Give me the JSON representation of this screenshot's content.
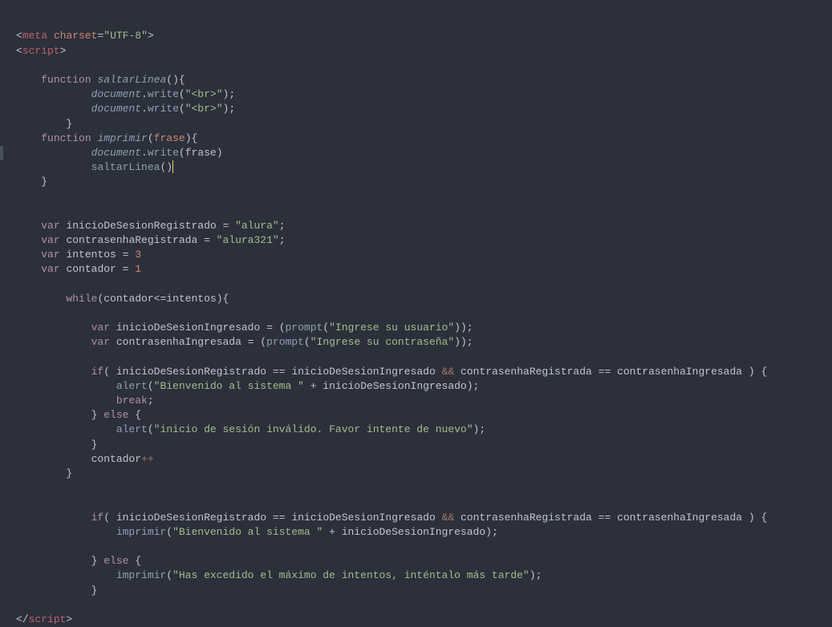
{
  "code": {
    "meta_open": "<",
    "meta_tag": "meta",
    "meta_attr": "charset",
    "meta_val": "\"UTF-8\"",
    "meta_close": ">",
    "script_open_l": "<",
    "script_tag": "script",
    "script_open_r": ">",
    "script_close_l": "</",
    "script_close_r": ">",
    "kw_function": "function",
    "fn_saltar": "saltarLinea",
    "paren_lr": "()",
    "brace_l": "{",
    "brace_r": "}",
    "doc": "document",
    "dot": ".",
    "write": "write",
    "paren_l": "(",
    "paren_r": ")",
    "br_str": "\"<br>\"",
    "semi": ";",
    "fn_imprimir": "imprimir",
    "param_frase": "frase",
    "kw_var": "var",
    "v_inicioReg": "inicioDeSesionRegistrado",
    "v_contraReg": "contrasenhaRegistrada",
    "v_intentos": "intentos",
    "v_contador": "contador",
    "v_inicioIng": "inicioDeSesionIngresado",
    "v_contraIng": "contrasenhaIngresada",
    "eq": " = ",
    "eq2": "=",
    "s_alura": "\"alura\"",
    "s_alura321": "\"alura321\"",
    "n_3": "3",
    "n_1": "1",
    "kw_while": "while",
    "lt_eq": "<=",
    "fn_prompt": "prompt",
    "s_ing_usuario": "\"Ingrese su usuario\"",
    "s_ing_contra": "\"Ingrese su contraseña\"",
    "kw_if": "if",
    "kw_else": "else",
    "cmp": "==",
    "and": "&&",
    "fn_alert": "alert",
    "s_bienvenido": "\"Bienvenido al sistema \"",
    "s_invalido": "\"inicio de sesión inválido. Favor intente de nuevo\"",
    "s_excedido": "\"Has excedido el máximo de intentos, inténtalo más tarde\"",
    "plus": " + ",
    "kw_break": "break",
    "inc": "++"
  }
}
